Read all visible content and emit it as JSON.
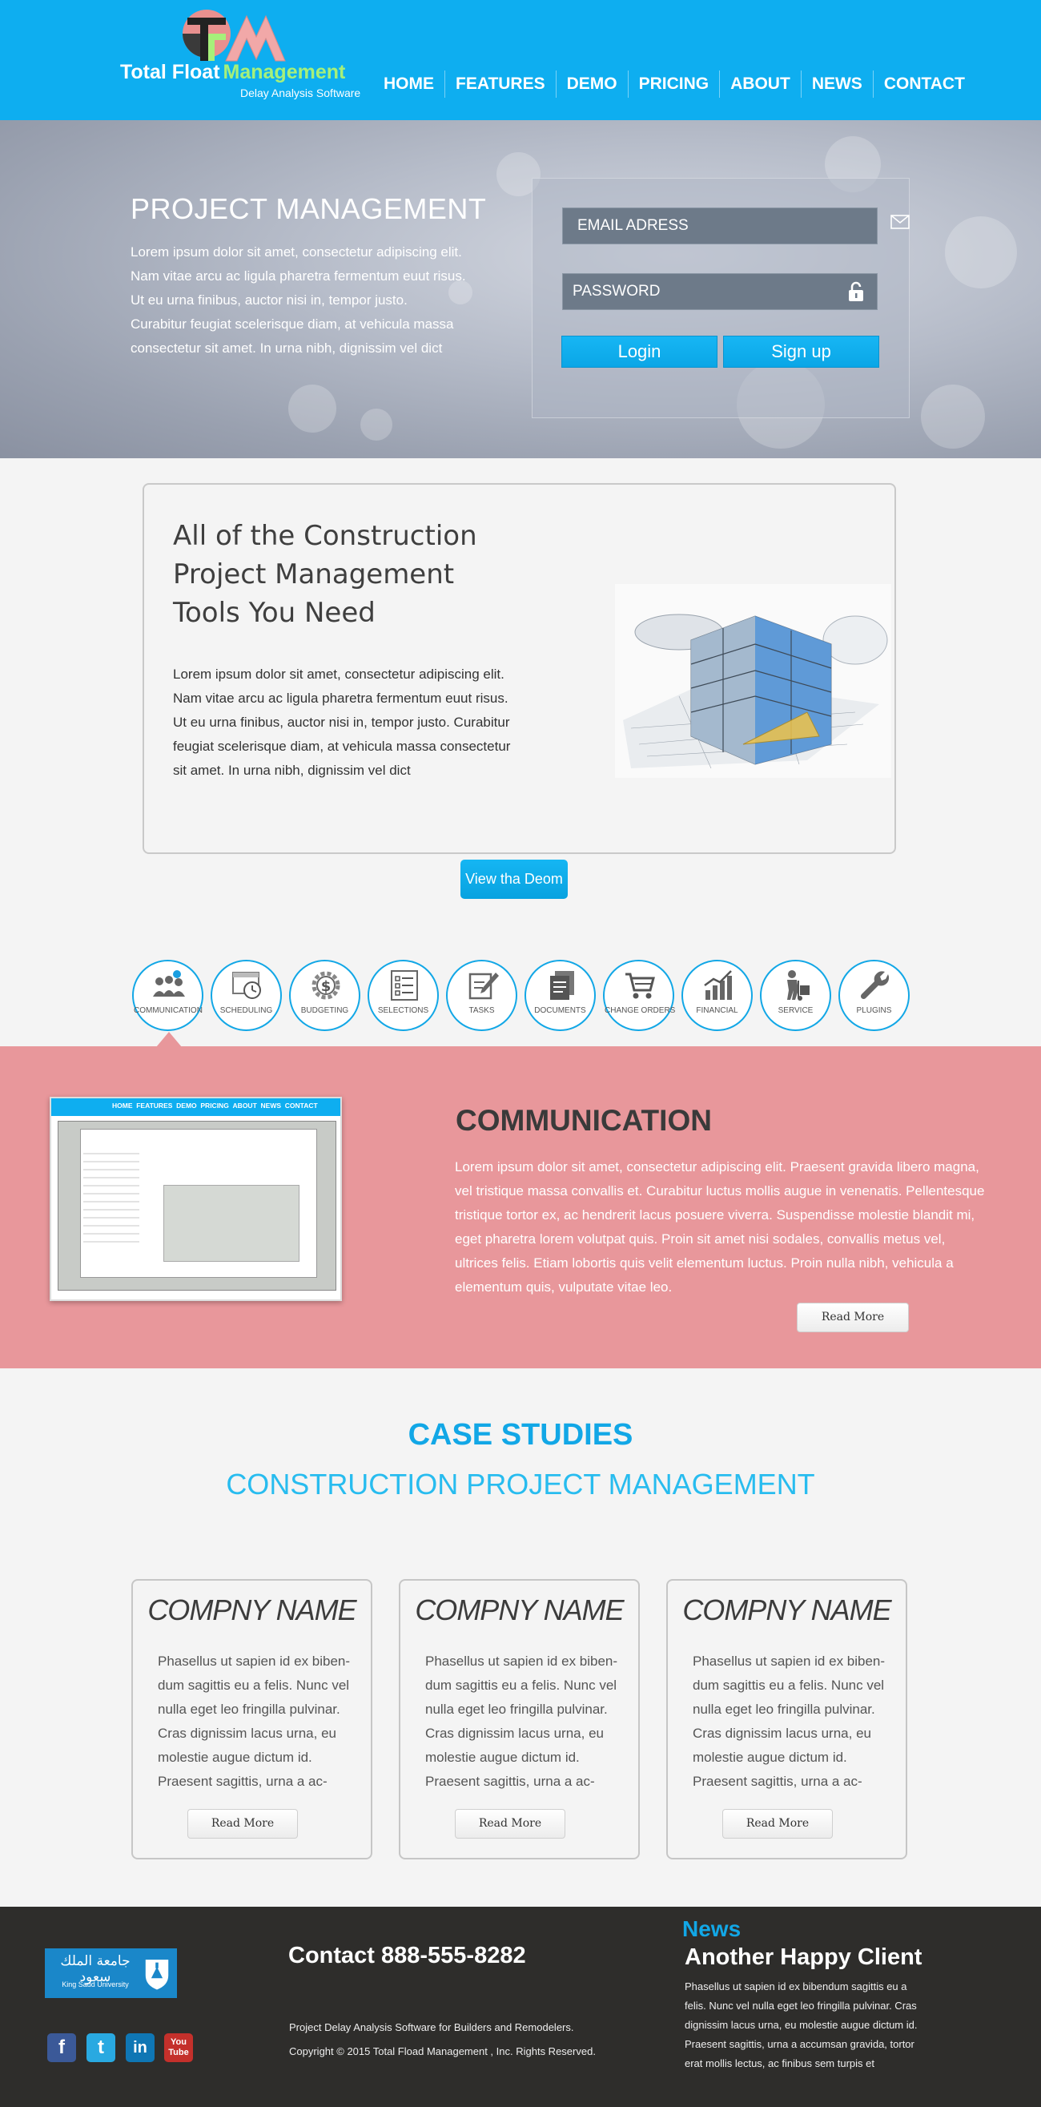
{
  "header": {
    "logo_title": "Total Float",
    "logo_title_accent": "Management",
    "logo_subtitle": "Delay Analysis Software",
    "nav": [
      "HOME",
      "FEATURES",
      "DEMO",
      "PRICING",
      "ABOUT",
      "NEWS",
      "CONTACT"
    ],
    "colors": {
      "bar": "#0eaef0",
      "accent": "#a6f07a"
    }
  },
  "hero": {
    "title": "PROJECT MANAGEMENT",
    "text": "Lorem ipsum dolor sit amet, consectetur adipiscing elit. Nam vitae arcu ac ligula pharetra fermentum euut risus. Ut eu urna finibus, auctor nisi in, tempor  justo. Curabitur feugiat scelerisque diam, at vehicula massa consectetur sit amet. In urna nibh, dignissim vel dict",
    "email_placeholder": "EMAIL ADRESS",
    "password_placeholder": "PASSWORD",
    "login_label": "Login",
    "signup_label": "Sign up"
  },
  "feature": {
    "title": "All of the Construction Project Management Tools You Need",
    "text": "Lorem ipsum dolor sit amet, consectetur adipiscing elit. Nam vitae arcu ac ligula pharetra fermentum euut risus. Ut eu urna finibus, auctor nisi in, tempor  justo. Curabitur feugiat scelerisque diam, at vehicula massa consectetur sit amet. In urna nibh, dignissim vel dict",
    "demo_button": "View tha Deom"
  },
  "icons": [
    {
      "label": "COMMUNICATION",
      "icon": "people-chat-icon"
    },
    {
      "label": "SCHEDULING",
      "icon": "calendar-clock-icon"
    },
    {
      "label": "BUDGETING",
      "icon": "dollar-gear-icon"
    },
    {
      "label": "SELECTIONS",
      "icon": "checklist-icon"
    },
    {
      "label": "TASKS",
      "icon": "notepad-pencil-icon"
    },
    {
      "label": "DOCUMENTS",
      "icon": "documents-icon"
    },
    {
      "label": "CHANGE ORDERS",
      "icon": "shopping-cart-icon"
    },
    {
      "label": "FINANCIAL",
      "icon": "bar-chart-icon"
    },
    {
      "label": "SERVICE",
      "icon": "worker-dolly-icon"
    },
    {
      "label": "PLUGINS",
      "icon": "wrench-icon"
    }
  ],
  "communication": {
    "title": "COMMUNICATION",
    "text": "Lorem ipsum dolor sit amet, consectetur adipiscing elit. Praesent gravida libero magna, vel tristique massa convallis et. Curabitur luctus mollis augue in venenatis. Pellentesque tristique tortor ex, ac hendrerit lacus posuere viverra. Suspendisse molestie blandit mi, eget pharetra lorem volutpat quis. Proin sit amet nisi sodales, convallis metus vel, ultrices felis. Etiam lobortis quis velit elementum luctus. Proin nulla nibh, vehicula a elementum quis, vulputate vitae leo.",
    "read_more": "Read More",
    "shot_nav": [
      "HOME",
      "FEATURES",
      "DEMO",
      "PRICING",
      "ABOUT",
      "NEWS",
      "CONTACT"
    ],
    "bg_color": "#e8979b"
  },
  "case_studies": {
    "title": "CASE STUDIES",
    "subtitle": "CONSTRUCTION PROJECT MANAGEMENT",
    "cards": [
      {
        "name": "COMPNY NAME",
        "text": "Phasellus ut sapien id ex biben-dum sagittis eu a felis. Nunc vel nulla eget leo fringilla pulvinar. Cras dignissim lacus urna, eu molestie augue dictum id. Praesent sagittis, urna a ac-",
        "button": "Read More"
      },
      {
        "name": "COMPNY NAME",
        "text": "Phasellus ut sapien id ex biben-dum sagittis eu a felis. Nunc vel nulla eget leo fringilla pulvinar. Cras dignissim lacus urna, eu molestie augue dictum id. Praesent sagittis, urna a ac-",
        "button": "Read More"
      },
      {
        "name": "COMPNY NAME",
        "text": "Phasellus ut sapien id ex biben-dum sagittis eu a felis. Nunc vel nulla eget leo fringilla pulvinar. Cras dignissim lacus urna, eu molestie augue dictum id. Praesent sagittis, urna a ac-",
        "button": "Read More"
      }
    ]
  },
  "footer": {
    "university_ar": "جامعة الملك سعود",
    "university_en": "King Saud University",
    "contact": "Contact  888-555-8282",
    "tagline": "Project Delay Analysis Software for Builders and Remodelers.",
    "copyright": "Copyright © 2015 Total Fload Management , Inc. Rights Reserved.",
    "news_label": "News",
    "news_title": "Another Happy Client",
    "news_text": "Phasellus ut sapien id ex bibendum sagittis eu a felis. Nunc vel nulla eget leo fringilla pulvinar. Cras dignissim lacus urna, eu molestie augue dictum id. Praesent sagittis, urna a accumsan gravida, tortor erat mollis lectus, ac finibus sem turpis et",
    "social": [
      {
        "icon": "facebook-icon",
        "label": "f",
        "color": "#3b5998"
      },
      {
        "icon": "twitter-icon",
        "label": "t",
        "color": "#29a9e1"
      },
      {
        "icon": "linkedin-icon",
        "label": "in",
        "color": "#0f76b4"
      },
      {
        "icon": "youtube-icon",
        "label": "You Tube",
        "color": "#c4302b"
      }
    ]
  }
}
